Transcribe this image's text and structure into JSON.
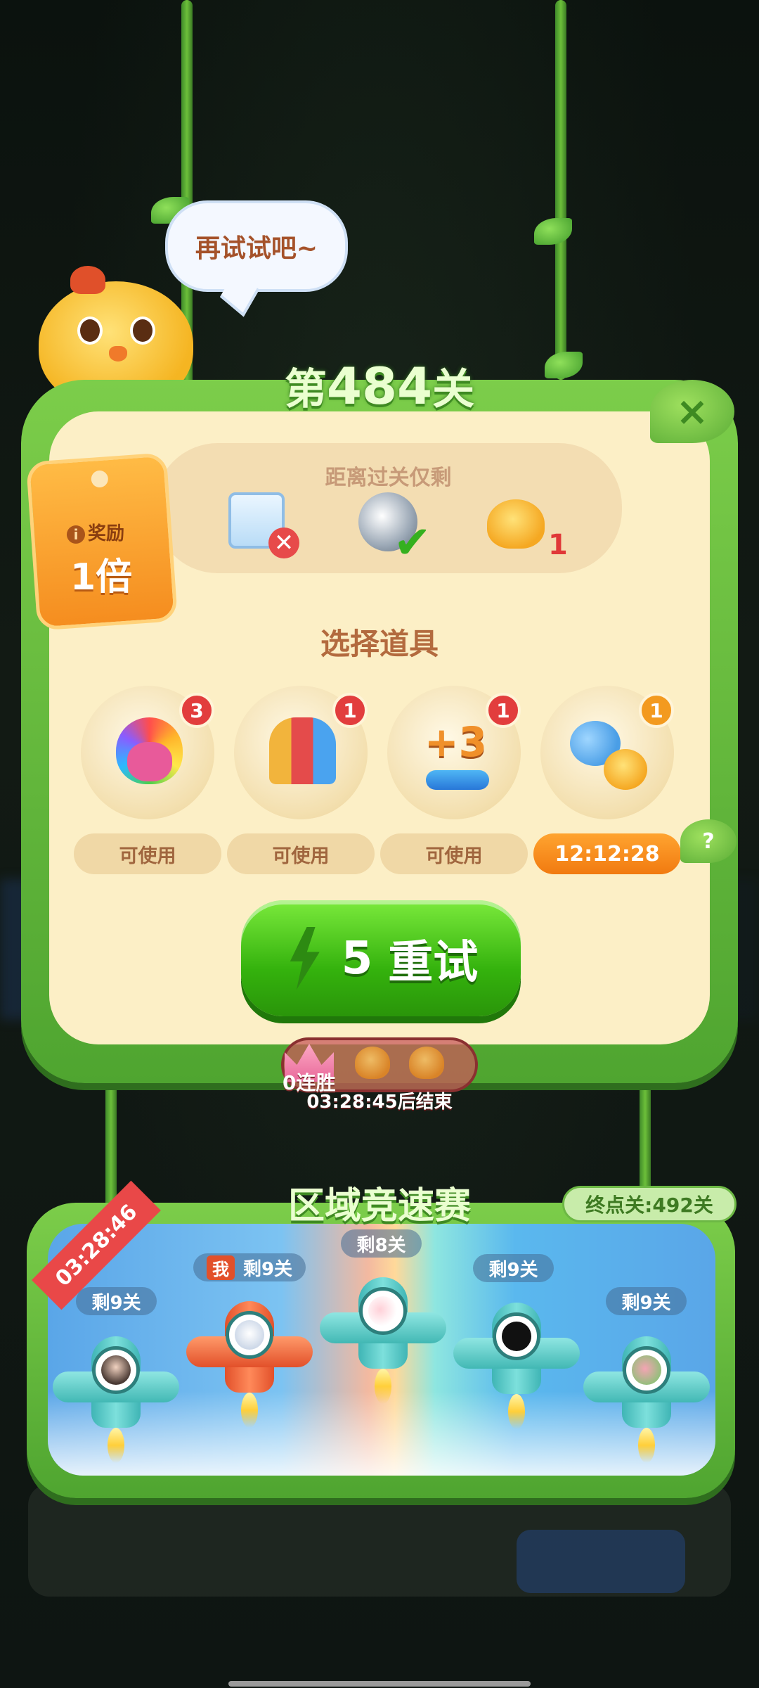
{
  "speech": "再试试吧~",
  "level": {
    "prefix": "第",
    "number": "484",
    "suffix": "关"
  },
  "goal": {
    "label": "距离过关仅剩",
    "items": [
      {
        "icon": "ice-block-icon",
        "status": "✕"
      },
      {
        "icon": "silver-coin-icon",
        "status": "✔"
      },
      {
        "icon": "chick-icon",
        "count": "1"
      }
    ]
  },
  "reward": {
    "label": "奖励",
    "info_icon": "i",
    "value": "1倍"
  },
  "select_title": "选择道具",
  "tools": [
    {
      "icon": "rainbow-owl-icon",
      "count": "3",
      "status": "可使用"
    },
    {
      "icon": "rocket-icon",
      "count": "1",
      "status": "可使用"
    },
    {
      "icon": "plus3-moves-icon",
      "count": "1",
      "icon_text": "+3",
      "status": "可使用"
    },
    {
      "icon": "swap-icon",
      "count": "1",
      "status": "12:12:28"
    }
  ],
  "help": "?",
  "retry": {
    "cost": "5",
    "label": "重试"
  },
  "close": "×",
  "streak": {
    "label": "0连胜",
    "ends": "03:28:45后结束"
  },
  "race": {
    "title": "区域竞速赛",
    "end_level": "终点关:492关",
    "timer": "03:28:46",
    "me_label": "我",
    "racers": [
      {
        "label": "剩9关"
      },
      {
        "label": "剩9关",
        "is_me": true
      },
      {
        "label": "剩8关"
      },
      {
        "label": "剩9关"
      },
      {
        "label": "剩9关"
      }
    ]
  },
  "colors": {
    "panel": "#fcefc6",
    "frame_green": "#5aac36",
    "badge_red": "#e23d3d",
    "timer_orange": "#f17a10",
    "retry_green": "#34b20d"
  }
}
